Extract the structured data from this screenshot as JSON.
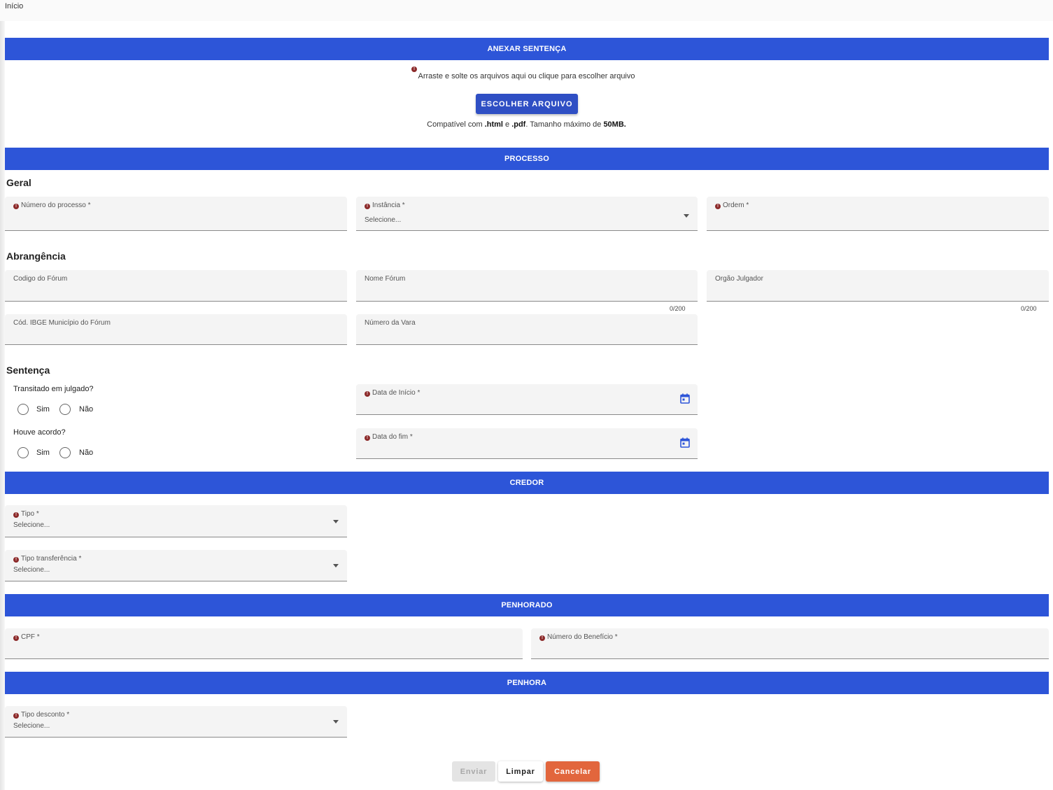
{
  "breadcrumb": "Início",
  "sections": {
    "attach": "ANEXAR SENTENÇA",
    "process": "PROCESSO",
    "creditor": "CREDOR",
    "pledged": "PENHORADO",
    "pledge": "PENHORA"
  },
  "attach": {
    "drop_text": "Arraste e solte os arquivos aqui ou clique para escolher arquivo",
    "choose_button": "ESCOLHER ARQUIVO",
    "compat_prefix": "Compatível com ",
    "compat_html": ".html",
    "compat_and": " e ",
    "compat_pdf": ".pdf",
    "compat_size": ". Tamanho máximo de ",
    "compat_max": "50MB."
  },
  "subheadings": {
    "general": "Geral",
    "scope": "Abrangência",
    "sentence": "Sentença"
  },
  "fields": {
    "process_number": "Número do processo *",
    "instance": "Instância *",
    "instance_value": "Selecione...",
    "order": "Ordem *",
    "forum_code": "Codigo do Fórum",
    "forum_name": "Nome Fórum",
    "forum_name_counter": "0/200",
    "judging_body": "Orgão Julgador",
    "judging_body_counter": "0/200",
    "ibge_code": "Cód. IBGE Município do Fórum",
    "court_number": "Número da Vara",
    "start_date": "Data de Início *",
    "end_date": "Data do fim *",
    "type": "Tipo *",
    "type_value": "Selecione...",
    "transfer_type": "Tipo transferência *",
    "transfer_type_value": "Selecione...",
    "cpf": "CPF *",
    "benefit_number": "Número do Benefício *",
    "discount_type": "Tipo desconto *",
    "discount_type_value": "Selecione..."
  },
  "questions": {
    "res_judicata": "Transitado em julgado?",
    "agreement": "Houve acordo?",
    "yes": "Sim",
    "no": "Não"
  },
  "actions": {
    "send": "Enviar",
    "clear": "Limpar",
    "cancel": "Cancelar"
  },
  "colors": {
    "section_bar": "#2d55d8",
    "primary_button": "#2f4fc4",
    "cancel_button": "#e2663d",
    "required_icon": "#8c2a2a"
  }
}
